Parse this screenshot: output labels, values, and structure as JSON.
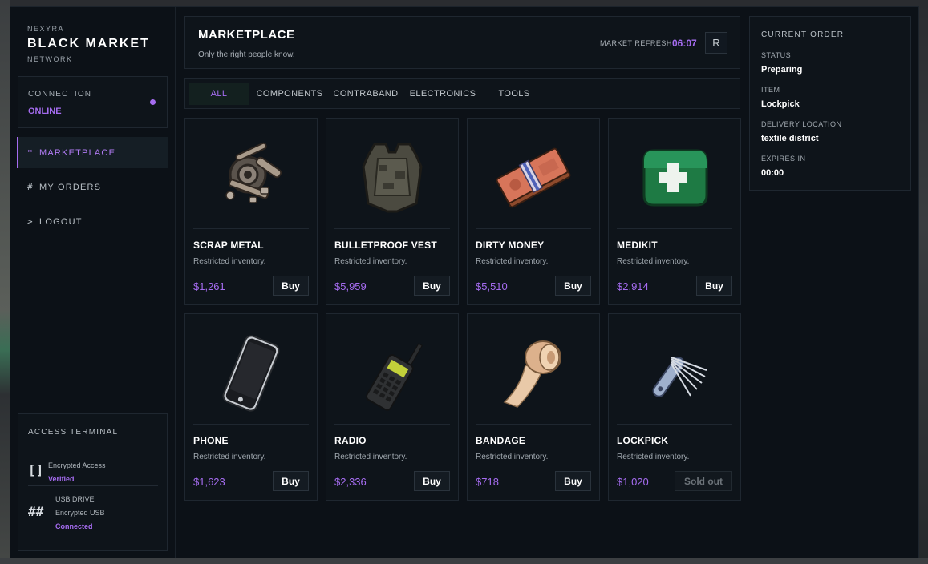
{
  "brand": {
    "top": "NEXYRA",
    "main": "BLACK MARKET",
    "sub": "NETWORK"
  },
  "connection": {
    "label": "CONNECTION",
    "value": "ONLINE"
  },
  "nav": [
    {
      "prefix": "*",
      "label": "MARKETPLACE",
      "active": true
    },
    {
      "prefix": "#",
      "label": "MY ORDERS",
      "active": false
    },
    {
      "prefix": ">",
      "label": "LOGOUT",
      "active": false
    }
  ],
  "access": {
    "title": "ACCESS TERMINAL",
    "items": [
      {
        "glyph": "[]",
        "line1": "Encrypted Access",
        "status": "Verified"
      },
      {
        "glyph": "##",
        "line1": "USB DRIVE",
        "line2": "Encrypted USB",
        "status": "Connected"
      }
    ]
  },
  "header": {
    "title": "MARKETPLACE",
    "subtitle": "Only the right people know.",
    "refresh_label": "MARKET REFRESH",
    "refresh_time": "06:07",
    "refresh_button": "R"
  },
  "tabs": [
    {
      "label": "ALL",
      "active": true
    },
    {
      "label": "COMPONENTS",
      "active": false
    },
    {
      "label": "CONTRABAND",
      "active": false
    },
    {
      "label": "ELECTRONICS",
      "active": false
    },
    {
      "label": "TOOLS",
      "active": false
    }
  ],
  "products": [
    {
      "name": "SCRAP METAL",
      "desc": "Restricted inventory.",
      "price": "$1,261",
      "button": "Buy",
      "icon": "scrap-metal-icon",
      "available": true
    },
    {
      "name": "BULLETPROOF VEST",
      "desc": "Restricted inventory.",
      "price": "$5,959",
      "button": "Buy",
      "icon": "vest-icon",
      "available": true
    },
    {
      "name": "DIRTY MONEY",
      "desc": "Restricted inventory.",
      "price": "$5,510",
      "button": "Buy",
      "icon": "money-icon",
      "available": true
    },
    {
      "name": "MEDIKIT",
      "desc": "Restricted inventory.",
      "price": "$2,914",
      "button": "Buy",
      "icon": "medikit-icon",
      "available": true
    },
    {
      "name": "PHONE",
      "desc": "Restricted inventory.",
      "price": "$1,623",
      "button": "Buy",
      "icon": "phone-icon",
      "available": true
    },
    {
      "name": "RADIO",
      "desc": "Restricted inventory.",
      "price": "$2,336",
      "button": "Buy",
      "icon": "radio-icon",
      "available": true
    },
    {
      "name": "BANDAGE",
      "desc": "Restricted inventory.",
      "price": "$718",
      "button": "Buy",
      "icon": "bandage-icon",
      "available": true
    },
    {
      "name": "LOCKPICK",
      "desc": "Restricted inventory.",
      "price": "$1,020",
      "button": "Sold out",
      "icon": "lockpick-icon",
      "available": false
    }
  ],
  "order": {
    "title": "CURRENT ORDER",
    "fields": [
      {
        "label": "STATUS",
        "value": "Preparing"
      },
      {
        "label": "ITEM",
        "value": "Lockpick"
      },
      {
        "label": "DELIVERY LOCATION",
        "value": "textile district"
      },
      {
        "label": "EXPIRES IN",
        "value": "00:00"
      }
    ]
  },
  "colors": {
    "accent": "#a56cf0",
    "panel": "#0e141a",
    "background": "#0c1117",
    "border": "#1f2730"
  }
}
